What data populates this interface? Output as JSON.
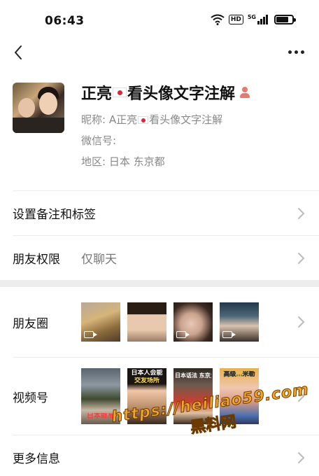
{
  "status_bar": {
    "time": "06:43",
    "hd_label": "HD",
    "network_label": "5G",
    "battery_level": 0.8
  },
  "nav": {
    "back_icon": "chevron-left-icon",
    "more_icon": "more-dots-icon"
  },
  "profile": {
    "display_name_part1": "正亮",
    "display_name_part2": "看头像文字注解",
    "nickname_label": "昵称:",
    "nickname_part1": "A正亮",
    "nickname_part2": "看头像文字注解",
    "wechat_id_label": "微信号:",
    "region_label": "地区:",
    "region_value": "日本  东京都"
  },
  "rows": {
    "remarks_label": "设置备注和标签",
    "permissions_label": "朋友权限",
    "permissions_value": "仅聊天",
    "moments_label": "朋友圈",
    "channels_label": "视频号",
    "more_info_label": "更多信息"
  },
  "channels_thumbs": {
    "t1_caption": "日本邮局",
    "t2_caption_top": "日本人会能",
    "t2_caption_sub": "交友场所",
    "t3_caption": "日本话法 东京大庆",
    "t4_caption": "高级…米勒"
  },
  "watermark": {
    "url": "https://heiliao59.com",
    "text": "黑料网"
  },
  "colors": {
    "background": "#ffffff",
    "section_gap": "#ededed",
    "secondary_text": "#888888",
    "watermark": "#f5a623"
  }
}
